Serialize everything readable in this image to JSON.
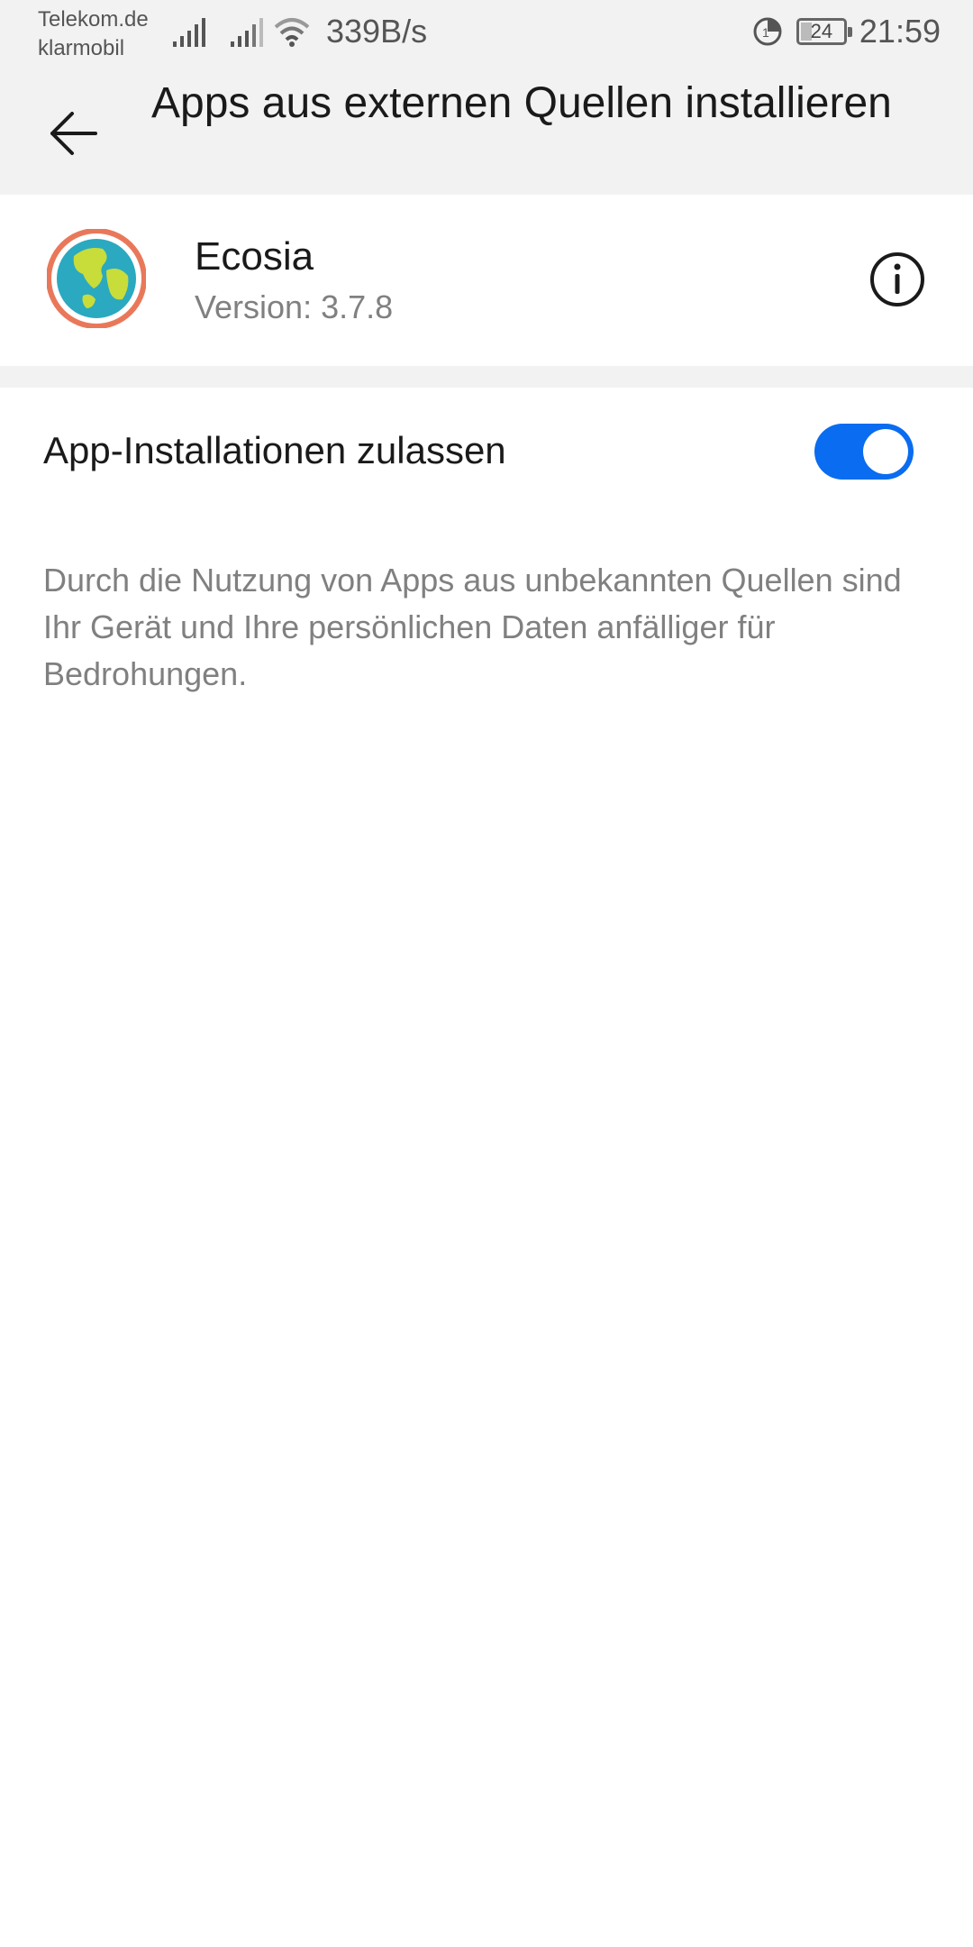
{
  "status_bar": {
    "carrier_line1": "Telekom.de",
    "carrier_line2": "klarmobil",
    "net_speed": "339B/s",
    "battery_level": "24",
    "time": "21:59"
  },
  "header": {
    "title": "Apps aus externen Quellen installieren",
    "back_icon": "arrow-back-icon"
  },
  "app": {
    "name": "Ecosia",
    "version": "Version: 3.7.8",
    "icon": "globe-icon",
    "info_icon": "info-icon"
  },
  "setting": {
    "label": "App-Installationen zulassen",
    "enabled": true
  },
  "warning": {
    "text": "Durch die Nutzung von Apps aus unbekannten Quellen sind Ihr Gerät und Ihre persönlichen Daten anfälliger für Bedrohungen."
  },
  "colors": {
    "accent": "#0a6cf0",
    "header_bg": "#f2f2f2"
  }
}
